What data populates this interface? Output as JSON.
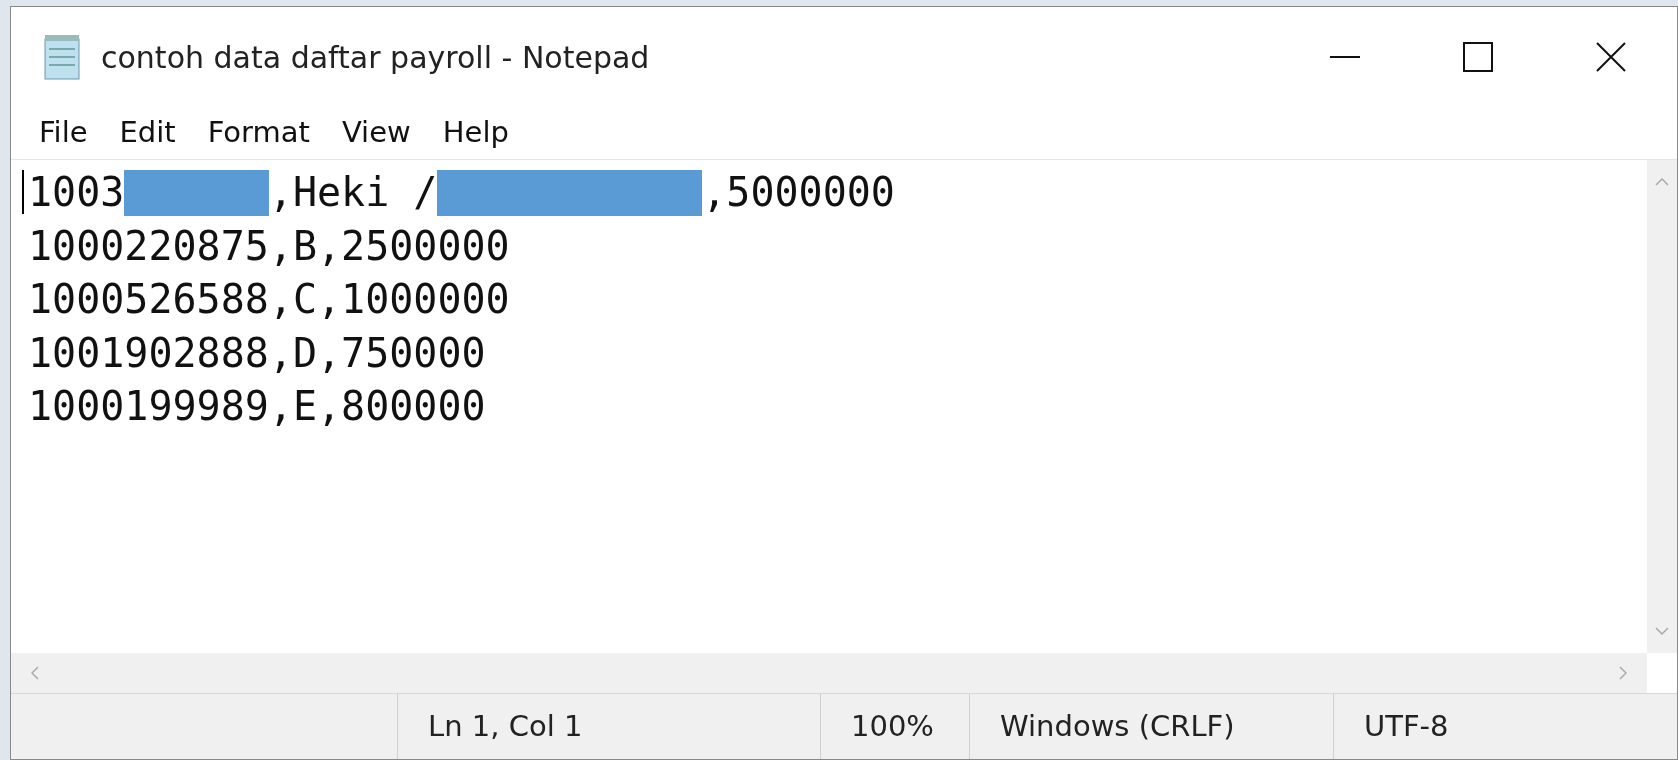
{
  "window": {
    "title": "contoh data daftar payroll - Notepad"
  },
  "menu": [
    "File",
    "Edit",
    "Format",
    "View",
    "Help"
  ],
  "editor": {
    "lines": [
      {
        "segments": [
          {
            "kind": "text",
            "text": "1003"
          },
          {
            "kind": "redaction",
            "color": "#5b9bd5"
          },
          {
            "kind": "text",
            "text": ",Heki /"
          },
          {
            "kind": "redaction",
            "color": "#5b9bd5"
          },
          {
            "kind": "text",
            "text": ",5000000"
          }
        ]
      },
      {
        "segments": [
          {
            "kind": "text",
            "text": "1000220875,B,2500000"
          }
        ]
      },
      {
        "segments": [
          {
            "kind": "text",
            "text": "1000526588,C,1000000"
          }
        ]
      },
      {
        "segments": [
          {
            "kind": "text",
            "text": "1001902888,D,750000"
          }
        ]
      },
      {
        "segments": [
          {
            "kind": "text",
            "text": "1000199989,E,800000"
          }
        ]
      }
    ]
  },
  "status_bar": [
    "Ln 1, Col 1",
    "100%",
    "Windows (CRLF)",
    "UTF-8"
  ]
}
